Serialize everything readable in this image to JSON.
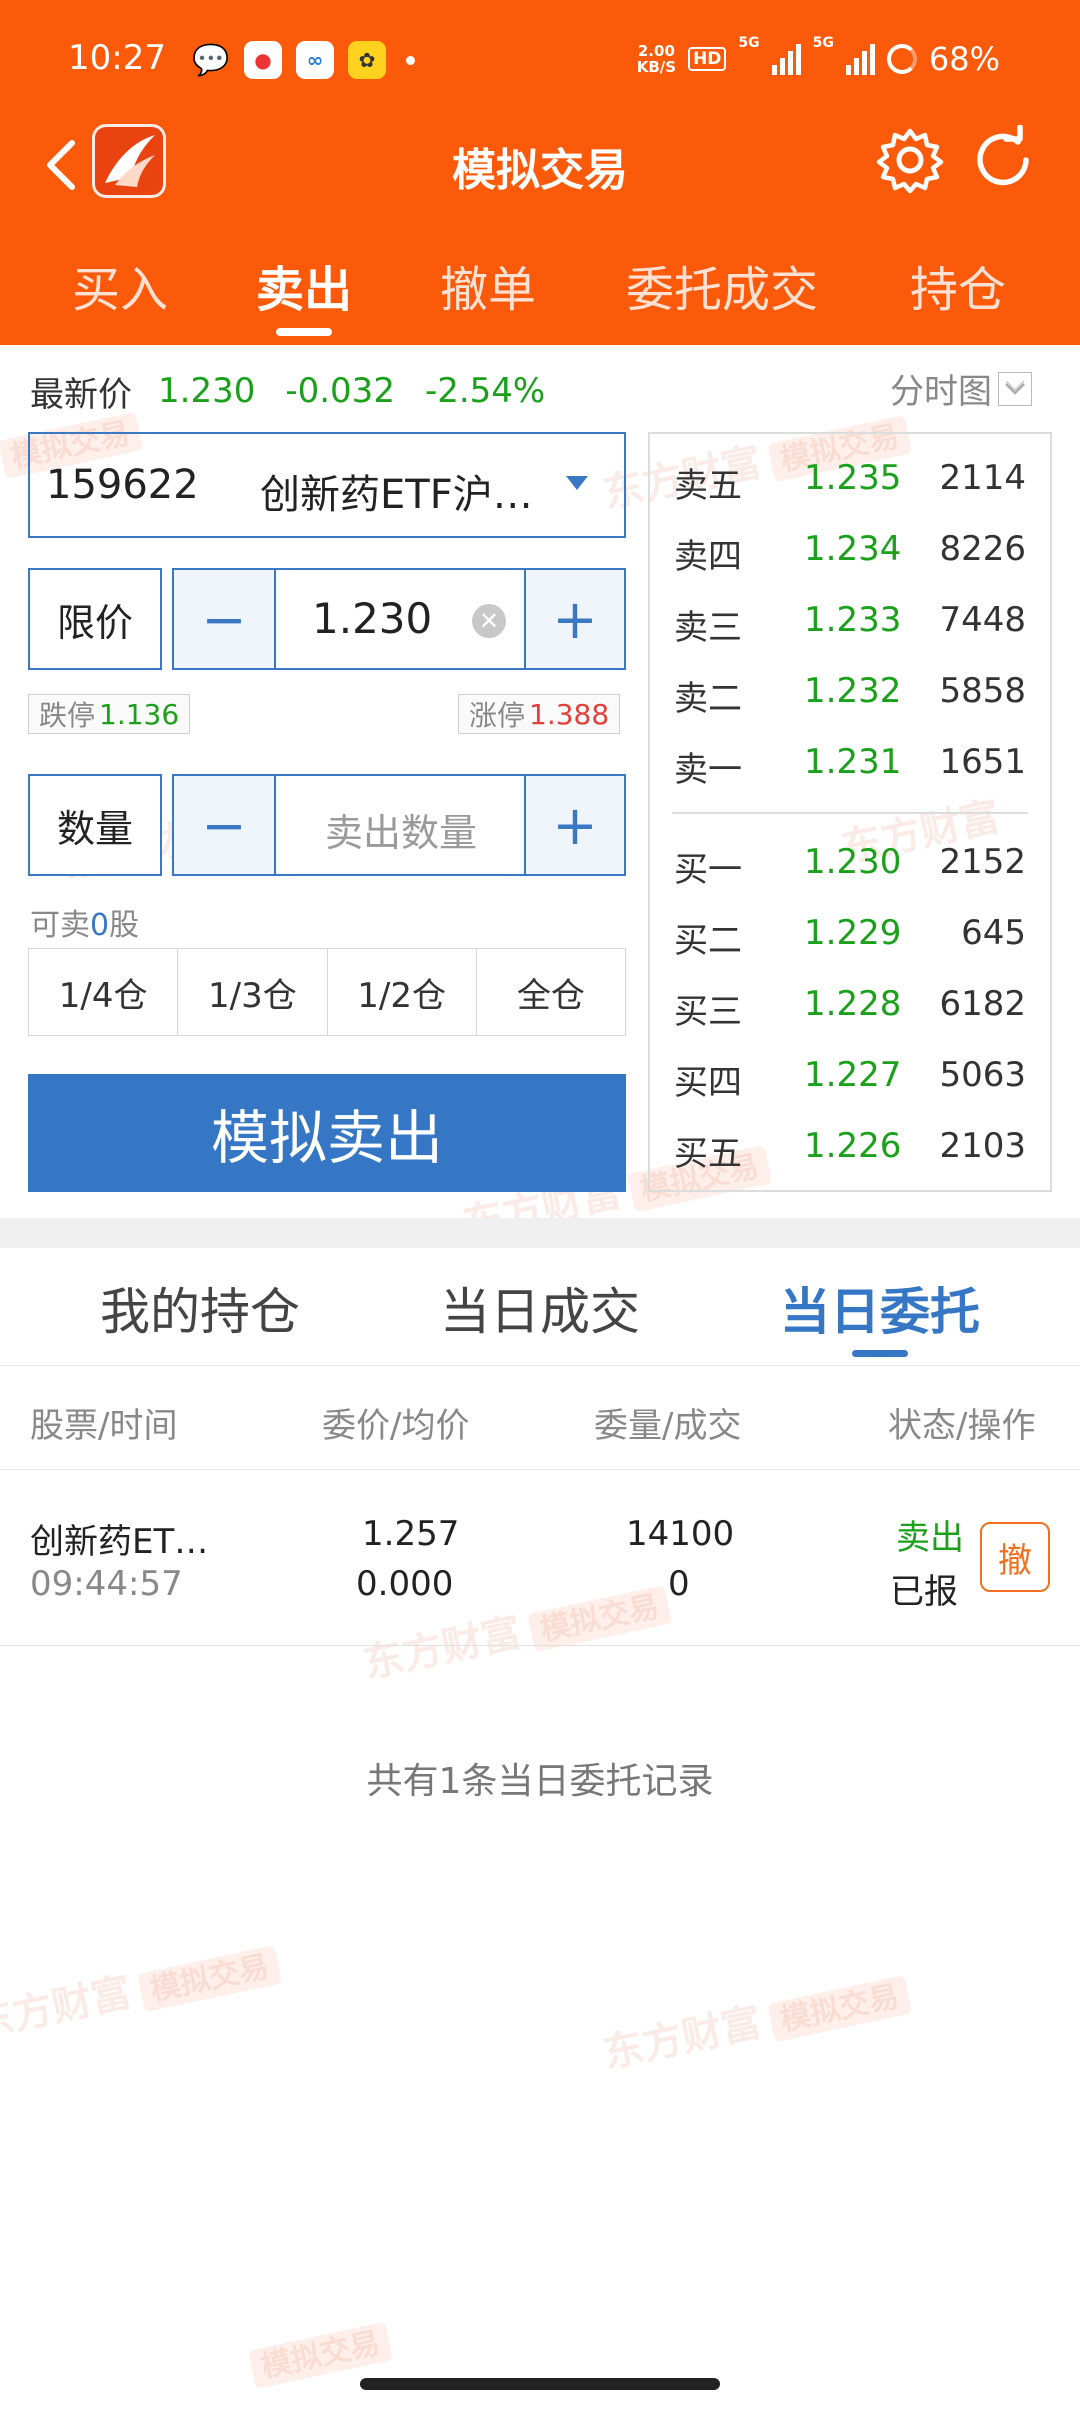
{
  "status_bar": {
    "time": "10:27",
    "speed_value": "2.00",
    "speed_unit": "KB/S",
    "hd_label": "HD",
    "net_label": "5G",
    "battery": "68%"
  },
  "app": {
    "title": "模拟交易"
  },
  "top_tabs": [
    {
      "label": "买入",
      "active": false
    },
    {
      "label": "卖出",
      "active": true
    },
    {
      "label": "撤单",
      "active": false
    },
    {
      "label": "委托成交",
      "active": false
    },
    {
      "label": "持仓",
      "active": false
    }
  ],
  "quote": {
    "label": "最新价",
    "price": "1.230",
    "change": "-0.032",
    "change_pct": "-2.54%",
    "chart_toggle": "分时图"
  },
  "form": {
    "stock_code": "159622",
    "stock_name": "创新药ETF沪…",
    "price_type": "限价",
    "price_value": "1.230",
    "minus": "−",
    "plus": "+",
    "limit_down_label": "跌停",
    "limit_down_value": "1.136",
    "limit_up_label": "涨停",
    "limit_up_value": "1.388",
    "qty_label": "数量",
    "qty_placeholder": "卖出数量",
    "can_sell_prefix": "可卖",
    "can_sell_value": "0",
    "can_sell_suffix": "股",
    "portions": [
      "1/4仓",
      "1/3仓",
      "1/2仓",
      "全仓"
    ],
    "submit_label": "模拟卖出"
  },
  "order_book": {
    "asks": [
      {
        "level": "卖五",
        "price": "1.235",
        "volume": "2114"
      },
      {
        "level": "卖四",
        "price": "1.234",
        "volume": "8226"
      },
      {
        "level": "卖三",
        "price": "1.233",
        "volume": "7448"
      },
      {
        "level": "卖二",
        "price": "1.232",
        "volume": "5858"
      },
      {
        "level": "卖一",
        "price": "1.231",
        "volume": "1651"
      }
    ],
    "bids": [
      {
        "level": "买一",
        "price": "1.230",
        "volume": "2152"
      },
      {
        "level": "买二",
        "price": "1.229",
        "volume": "645"
      },
      {
        "level": "买三",
        "price": "1.228",
        "volume": "6182"
      },
      {
        "level": "买四",
        "price": "1.227",
        "volume": "5063"
      },
      {
        "level": "买五",
        "price": "1.226",
        "volume": "2103"
      }
    ]
  },
  "bottom_tabs": [
    {
      "label": "我的持仓",
      "active": false
    },
    {
      "label": "当日成交",
      "active": false
    },
    {
      "label": "当日委托",
      "active": true
    }
  ],
  "table": {
    "headers": [
      "股票/时间",
      "委价/均价",
      "委量/成交",
      "状态/操作"
    ],
    "rows": [
      {
        "name": "创新药ET…",
        "time": "09:44:57",
        "order_price": "1.257",
        "avg_price": "0.000",
        "order_qty": "14100",
        "filled_qty": "0",
        "side": "卖出",
        "status": "已报",
        "action": "撤"
      }
    ]
  },
  "summary": "共有1条当日委托记录",
  "watermark": {
    "brand": "东方财富",
    "tag": "模拟交易"
  },
  "colors": {
    "header_orange": "#fa5a0a",
    "accent_blue": "#3577c4",
    "down_green": "#1aa01a",
    "up_red": "#e0413a",
    "cancel_orange": "#f07020"
  }
}
